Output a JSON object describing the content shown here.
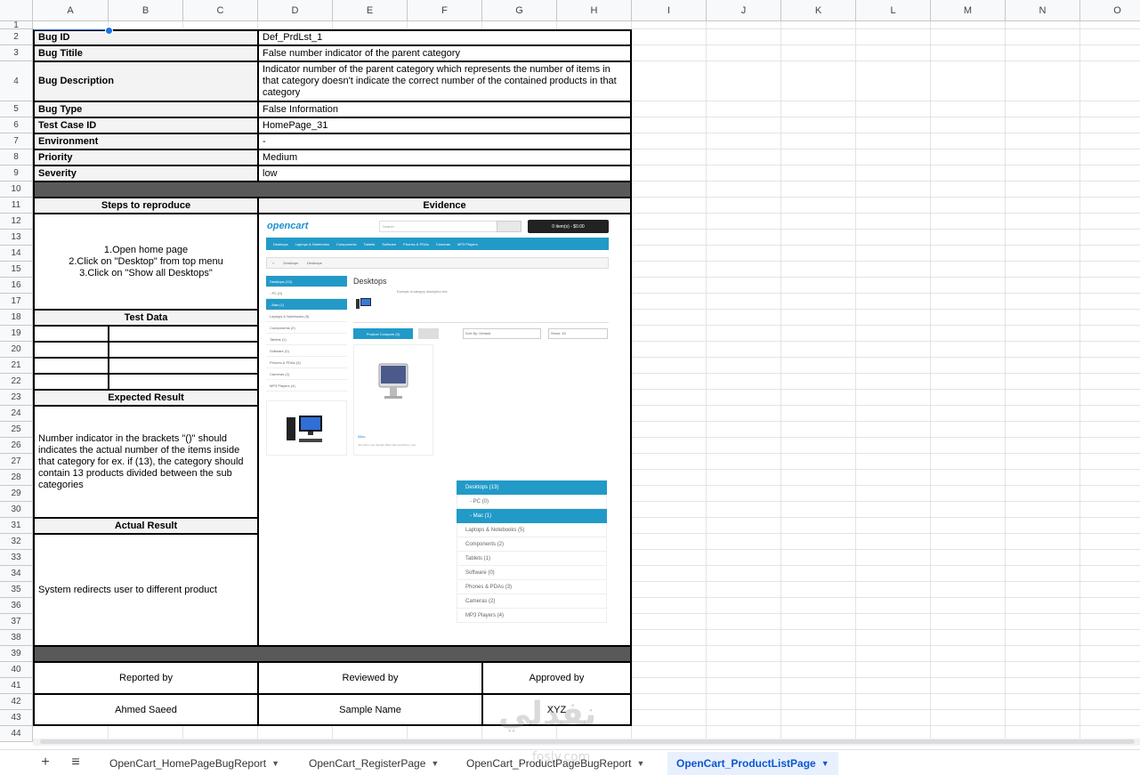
{
  "columns": [
    "A",
    "B",
    "C",
    "D",
    "E",
    "F",
    "G",
    "H",
    "I",
    "J",
    "K",
    "L",
    "M",
    "N",
    "O"
  ],
  "rows": [
    "1",
    "2",
    "3",
    "4",
    "5",
    "6",
    "7",
    "8",
    "9",
    "10",
    "11",
    "12",
    "13",
    "14",
    "15",
    "16",
    "17",
    "18",
    "19",
    "20",
    "21",
    "22",
    "23",
    "24",
    "25",
    "26",
    "27",
    "28",
    "29",
    "30",
    "31",
    "32",
    "33",
    "34",
    "35",
    "36",
    "37",
    "38",
    "39",
    "40",
    "41",
    "42",
    "43",
    "44"
  ],
  "report": {
    "fields": [
      {
        "label": "Bug ID",
        "value": "Def_PrdLst_1"
      },
      {
        "label": "Bug Titile",
        "value": "False number indicator of the parent category"
      },
      {
        "label": "Bug Description",
        "value": "Indicator number of the parent category which represents the number of items in that category doesn't indicate the correct number of the contained products in that category"
      },
      {
        "label": "Bug Type",
        "value": "False Information"
      },
      {
        "label": "Test Case ID",
        "value": "HomePage_31"
      },
      {
        "label": "Environment",
        "value": "-"
      },
      {
        "label": "Priority",
        "value": "Medium"
      },
      {
        "label": "Severity",
        "value": "low"
      }
    ],
    "steps_header": "Steps to reproduce",
    "steps": [
      "1.Open home page",
      "2.Click on \"Desktop\" from top menu",
      "3.Click on \"Show all Desktops\""
    ],
    "evidence_header": "Evidence",
    "test_data_header": "Test Data",
    "expected_header": "Expected Result",
    "expected": "Number indicator in the brackets \"()\" should indicates the actual number of the items inside that category for ex. if (13), the category should contain 13 products divided between the sub categories",
    "actual_header": "Actual Result",
    "actual": "System redirects user to different product",
    "signoff": {
      "reported_label": "Reported by",
      "reviewed_label": "Reviewed by",
      "approved_label": "Approved by",
      "reported_value": "Ahmed Saeed",
      "reviewed_value": "Sample Name",
      "approved_value": "XYZ"
    }
  },
  "evidence": {
    "logo": "opencart",
    "search_placeholder": "Search",
    "cart": "0 item(s) - $0.00",
    "menu": [
      "Desktops",
      "Laptops & Notebooks",
      "Components",
      "Tablets",
      "Software",
      "Phones & PDAs",
      "Cameras",
      "MP3 Players"
    ],
    "breadcrumb": [
      "Desktops",
      "Desktops"
    ],
    "side": [
      "Desktops (13)",
      "- PC (0)",
      "- Mac (1)",
      "Laptops & Notebooks (5)",
      "Components (2)",
      "Tablets (1)",
      "Software (0)",
      "Phones & PDAs (3)",
      "Cameras (2)",
      "MP3 Players (4)"
    ],
    "heading": "Desktops",
    "desc": "Example of category description text",
    "compare": "Product Compare (0)",
    "sort": "Sort By: Default",
    "show": "Show: 15",
    "product_name": "iMac",
    "product_desc": "Just when you thought iMac had everything, now..."
  },
  "zoom_categories": [
    "Desktops (13)",
    "- PC (0)",
    "- Mac (1)",
    "Laptops & Notebooks (5)",
    "Components (2)",
    "Tablets (1)",
    "Software (0)",
    "Phones & PDAs (3)",
    "Cameras (2)",
    "MP3 Players (4)"
  ],
  "sheets": [
    "OpenCart_HomePageBugReport",
    "OpenCart_RegisterPage",
    "OpenCart_ProductPageBugReport",
    "OpenCart_ProductListPage"
  ],
  "active_sheet": "OpenCart_ProductListPage",
  "watermark": "نفذلي",
  "watermark_url": "fosly.com",
  "colors": {
    "accent": "#229ac8",
    "active_tab": "#0b57d0"
  }
}
